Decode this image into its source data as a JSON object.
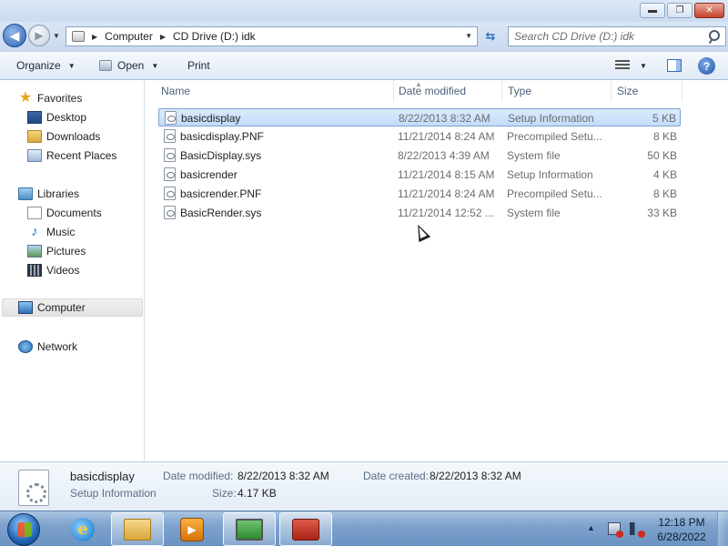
{
  "window": {
    "caption_minimize": "▬",
    "caption_maximize": "❐",
    "caption_close": "✕"
  },
  "address": {
    "crumbs": [
      "Computer",
      "CD Drive (D:) idk"
    ],
    "search_placeholder": "Search CD Drive (D:) idk"
  },
  "toolbar": {
    "organize_label": "Organize",
    "open_label": "Open",
    "print_label": "Print"
  },
  "sidebar": {
    "favorites": {
      "label": "Favorites",
      "items": [
        "Desktop",
        "Downloads",
        "Recent Places"
      ]
    },
    "libraries": {
      "label": "Libraries",
      "items": [
        "Documents",
        "Music",
        "Pictures",
        "Videos"
      ]
    },
    "computer_label": "Computer",
    "network_label": "Network"
  },
  "columns": [
    "Name",
    "Date modified",
    "Type",
    "Size"
  ],
  "files": [
    {
      "name": "basicdisplay",
      "date": "8/22/2013 8:32 AM",
      "type": "Setup Information",
      "size": "5 KB",
      "selected": true
    },
    {
      "name": "basicdisplay.PNF",
      "date": "11/21/2014 8:24 AM",
      "type": "Precompiled Setu...",
      "size": "8 KB"
    },
    {
      "name": "BasicDisplay.sys",
      "date": "8/22/2013 4:39 AM",
      "type": "System file",
      "size": "50 KB"
    },
    {
      "name": "basicrender",
      "date": "11/21/2014 8:15 AM",
      "type": "Setup Information",
      "size": "4 KB"
    },
    {
      "name": "basicrender.PNF",
      "date": "11/21/2014 8:24 AM",
      "type": "Precompiled Setu...",
      "size": "8 KB"
    },
    {
      "name": "BasicRender.sys",
      "date": "11/21/2014 12:52 ...",
      "type": "System file",
      "size": "33 KB"
    }
  ],
  "details": {
    "name": "basicdisplay",
    "type": "Setup Information",
    "date_modified_label": "Date modified:",
    "date_modified": "8/22/2013 8:32 AM",
    "date_created_label": "Date created:",
    "date_created": "8/22/2013 8:32 AM",
    "size_label": "Size:",
    "size": "4.17 KB"
  },
  "taskbar": {
    "time": "12:18 PM",
    "date": "6/28/2022"
  }
}
